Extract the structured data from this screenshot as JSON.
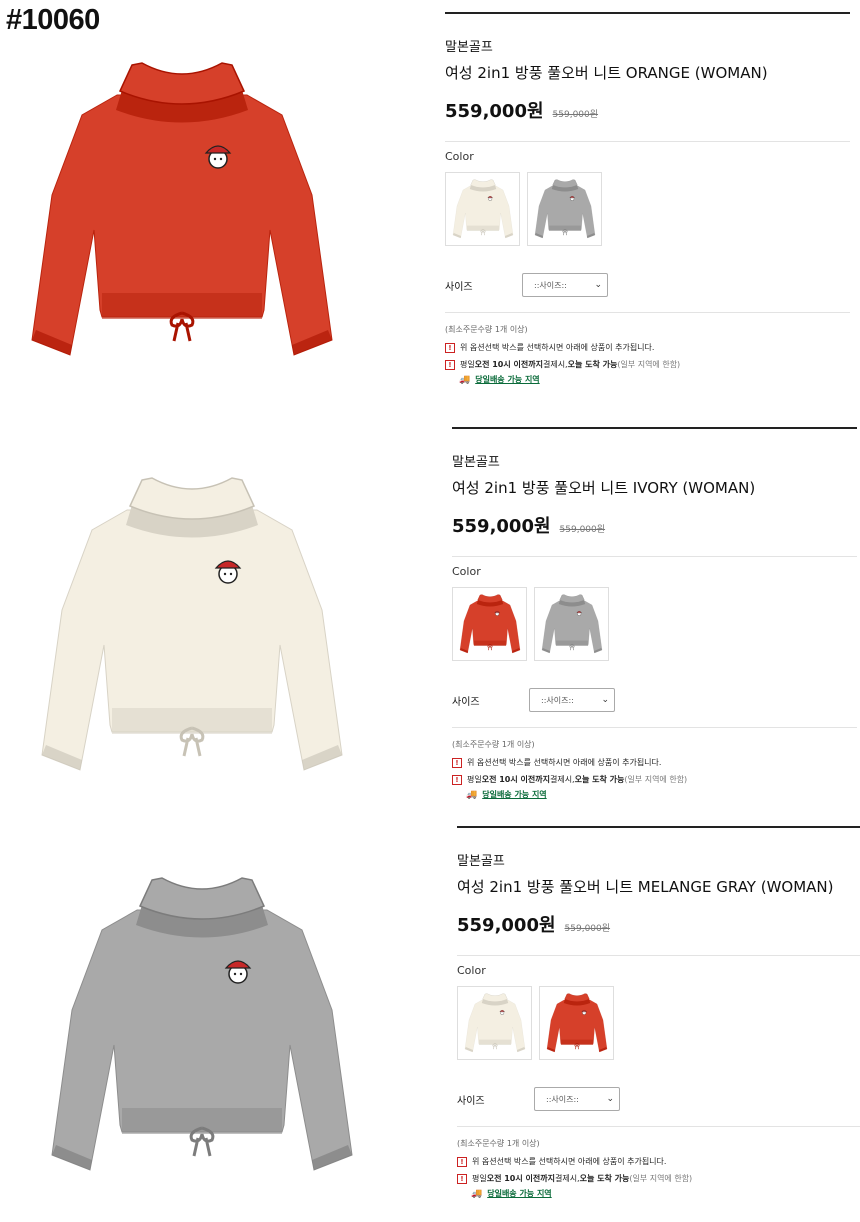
{
  "post_id": "#10060",
  "products": [
    {
      "brand": "말본골프",
      "title": "여성 2in1 방풍 풀오버 니트 ORANGE (WOMAN)",
      "price": "559,000원",
      "original_price": "559,000원",
      "color_label": "Color",
      "color_options": [
        "ivory",
        "melange gray"
      ],
      "size_label": "사이즈",
      "size_select": "::사이즈::",
      "min_qty": "(최소주문수량 1개 이상)",
      "notice1": "위 옵션선택 박스를 선택하시면 아래에 상품이 추가됩니다.",
      "notice2_a": "평일 ",
      "notice2_b": "오전 10시 이전까지",
      "notice2_c": " 결제시, ",
      "notice2_d": "오늘 도착 가능",
      "notice2_e": " (일부 지역에 한함)",
      "delivery_link": "당일배송 가능 지역",
      "image_color": "#d6402a"
    },
    {
      "brand": "말본골프",
      "title": "여성 2in1 방풍 풀오버 니트 IVORY (WOMAN)",
      "price": "559,000원",
      "original_price": "559,000원",
      "color_label": "Color",
      "color_options": [
        "orange",
        "melange gray"
      ],
      "size_label": "사이즈",
      "size_select": "::사이즈::",
      "min_qty": "(최소주문수량 1개 이상)",
      "notice1": "위 옵션선택 박스를 선택하시면 아래에 상품이 추가됩니다.",
      "notice2_a": "평일 ",
      "notice2_b": "오전 10시 이전까지",
      "notice2_c": " 결제시, ",
      "notice2_d": "오늘 도착 가능",
      "notice2_e": " (일부 지역에 한함)",
      "delivery_link": "당일배송 가능 지역",
      "image_color": "#f4efe2"
    },
    {
      "brand": "말본골프",
      "title": "여성 2in1 방풍 풀오버 니트 MELANGE GRAY (WOMAN)",
      "price": "559,000원",
      "original_price": "559,000원",
      "color_label": "Color",
      "color_options": [
        "ivory",
        "orange"
      ],
      "size_label": "사이즈",
      "size_select": "::사이즈::",
      "min_qty": "(최소주문수량 1개 이상)",
      "notice1": "위 옵션선택 박스를 선택하시면 아래에 상품이 추가됩니다.",
      "notice2_a": "평일 ",
      "notice2_b": "오전 10시 이전까지",
      "notice2_c": " 결제시, ",
      "notice2_d": "오늘 도착 가능",
      "notice2_e": " (일부 지역에 한함)",
      "delivery_link": "당일배송 가능 지역",
      "image_color": "#a9a9a9"
    }
  ],
  "colors": {
    "orange": "#d6402a",
    "ivory": "#f4efe2",
    "melange gray": "#a9a9a9",
    "link_green": "#0a6b3a",
    "warn_red": "#cc2222"
  }
}
